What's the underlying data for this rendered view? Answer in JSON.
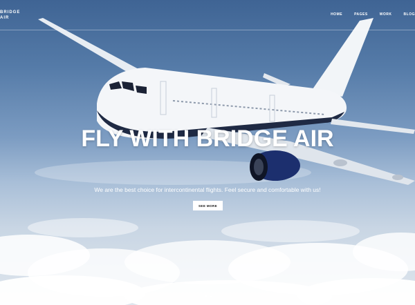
{
  "brand": {
    "line1": "BRIDGE",
    "line2": "AIR"
  },
  "nav": {
    "items": [
      "HOME",
      "PAGES",
      "WORK",
      "BLOG"
    ]
  },
  "hero": {
    "title": "FLY WITH BRIDGE AIR",
    "subtitle": "We are the best choice for intercontinental flights. Feel secure and comfortable with us!",
    "cta_label": "SEE MORE"
  },
  "slider": {
    "slides": 2,
    "active": 1
  }
}
